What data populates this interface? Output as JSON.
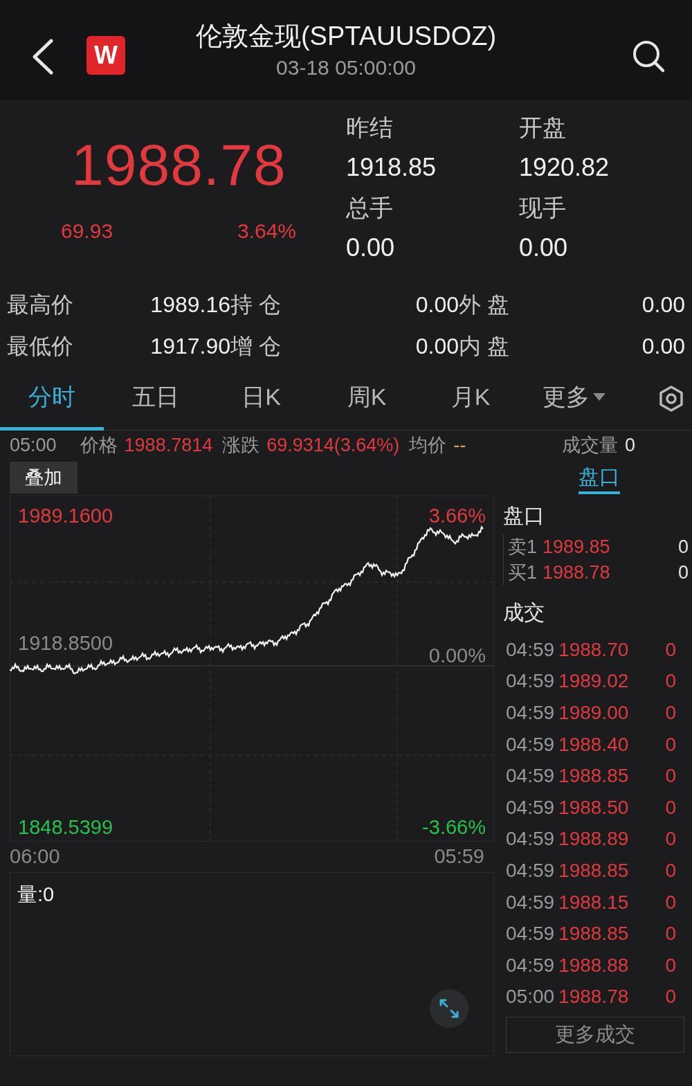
{
  "header": {
    "logo_letter": "W",
    "title": "伦敦金现(SPTAUUSDOZ)",
    "timestamp": "03-18 05:00:00"
  },
  "quote": {
    "price": "1988.78",
    "change": "69.93",
    "change_percent": "3.64%",
    "fields": [
      {
        "label": "昨结",
        "value": "1918.85"
      },
      {
        "label": "开盘",
        "value": "1920.82"
      },
      {
        "label": "总手",
        "value": "0.00"
      },
      {
        "label": "现手",
        "value": "0.00"
      }
    ]
  },
  "stats": [
    {
      "items": [
        {
          "label": "最高价",
          "value": "1989.16"
        },
        {
          "label": "持 仓",
          "value": "0.00"
        },
        {
          "label": "外 盘",
          "value": "0.00"
        }
      ]
    },
    {
      "items": [
        {
          "label": "最低价",
          "value": "1917.90"
        },
        {
          "label": "增 仓",
          "value": "0.00"
        },
        {
          "label": "内 盘",
          "value": "0.00"
        }
      ]
    }
  ],
  "tabs": [
    {
      "label": "分时",
      "selected": true,
      "kind": "tab"
    },
    {
      "label": "五日",
      "selected": false,
      "kind": "tab"
    },
    {
      "label": "日K",
      "selected": false,
      "kind": "tab"
    },
    {
      "label": "周K",
      "selected": false,
      "kind": "tab"
    },
    {
      "label": "月K",
      "selected": false,
      "kind": "tab"
    },
    {
      "label": "更多",
      "selected": false,
      "kind": "dropdown"
    }
  ],
  "info_bar": {
    "time": "05:00",
    "items": [
      {
        "label": "价格",
        "value": "1988.7814",
        "color": "#e0393e"
      },
      {
        "label": "涨跌",
        "value": "69.9314(3.64%)",
        "color": "#e0393e"
      },
      {
        "label": "均价",
        "value": "--",
        "color": "#d4b23a"
      }
    ],
    "volume_label": "成交量",
    "volume": "0"
  },
  "overlay_button": "叠加",
  "side_tab": {
    "label": "盘口",
    "selected": true
  },
  "chart": {
    "high": "1989.1600",
    "high_pct": "3.66%",
    "mid": "1918.8500",
    "mid_pct": "0.00%",
    "low": "1848.5399",
    "low_pct": "-3.66%",
    "time_start": "06:00",
    "time_end": "05:59"
  },
  "volume": {
    "label": "量:0"
  },
  "order_book": {
    "title": "盘口",
    "rows": [
      {
        "side": "卖1",
        "price": "1989.85",
        "qty": "0"
      },
      {
        "side": "买1",
        "price": "1988.78",
        "qty": "0"
      }
    ]
  },
  "trades": {
    "title": "成交",
    "rows": [
      {
        "time": "04:59",
        "price": "1988.70",
        "qty": "0"
      },
      {
        "time": "04:59",
        "price": "1989.02",
        "qty": "0"
      },
      {
        "time": "04:59",
        "price": "1989.00",
        "qty": "0"
      },
      {
        "time": "04:59",
        "price": "1988.40",
        "qty": "0"
      },
      {
        "time": "04:59",
        "price": "1988.85",
        "qty": "0"
      },
      {
        "time": "04:59",
        "price": "1988.50",
        "qty": "0"
      },
      {
        "time": "04:59",
        "price": "1988.89",
        "qty": "0"
      },
      {
        "time": "04:59",
        "price": "1988.85",
        "qty": "0"
      },
      {
        "time": "04:59",
        "price": "1988.15",
        "qty": "0"
      },
      {
        "time": "04:59",
        "price": "1988.85",
        "qty": "0"
      },
      {
        "time": "04:59",
        "price": "1988.88",
        "qty": "0"
      },
      {
        "time": "05:00",
        "price": "1988.78",
        "qty": "0"
      }
    ],
    "more_button": "更多成交"
  }
}
